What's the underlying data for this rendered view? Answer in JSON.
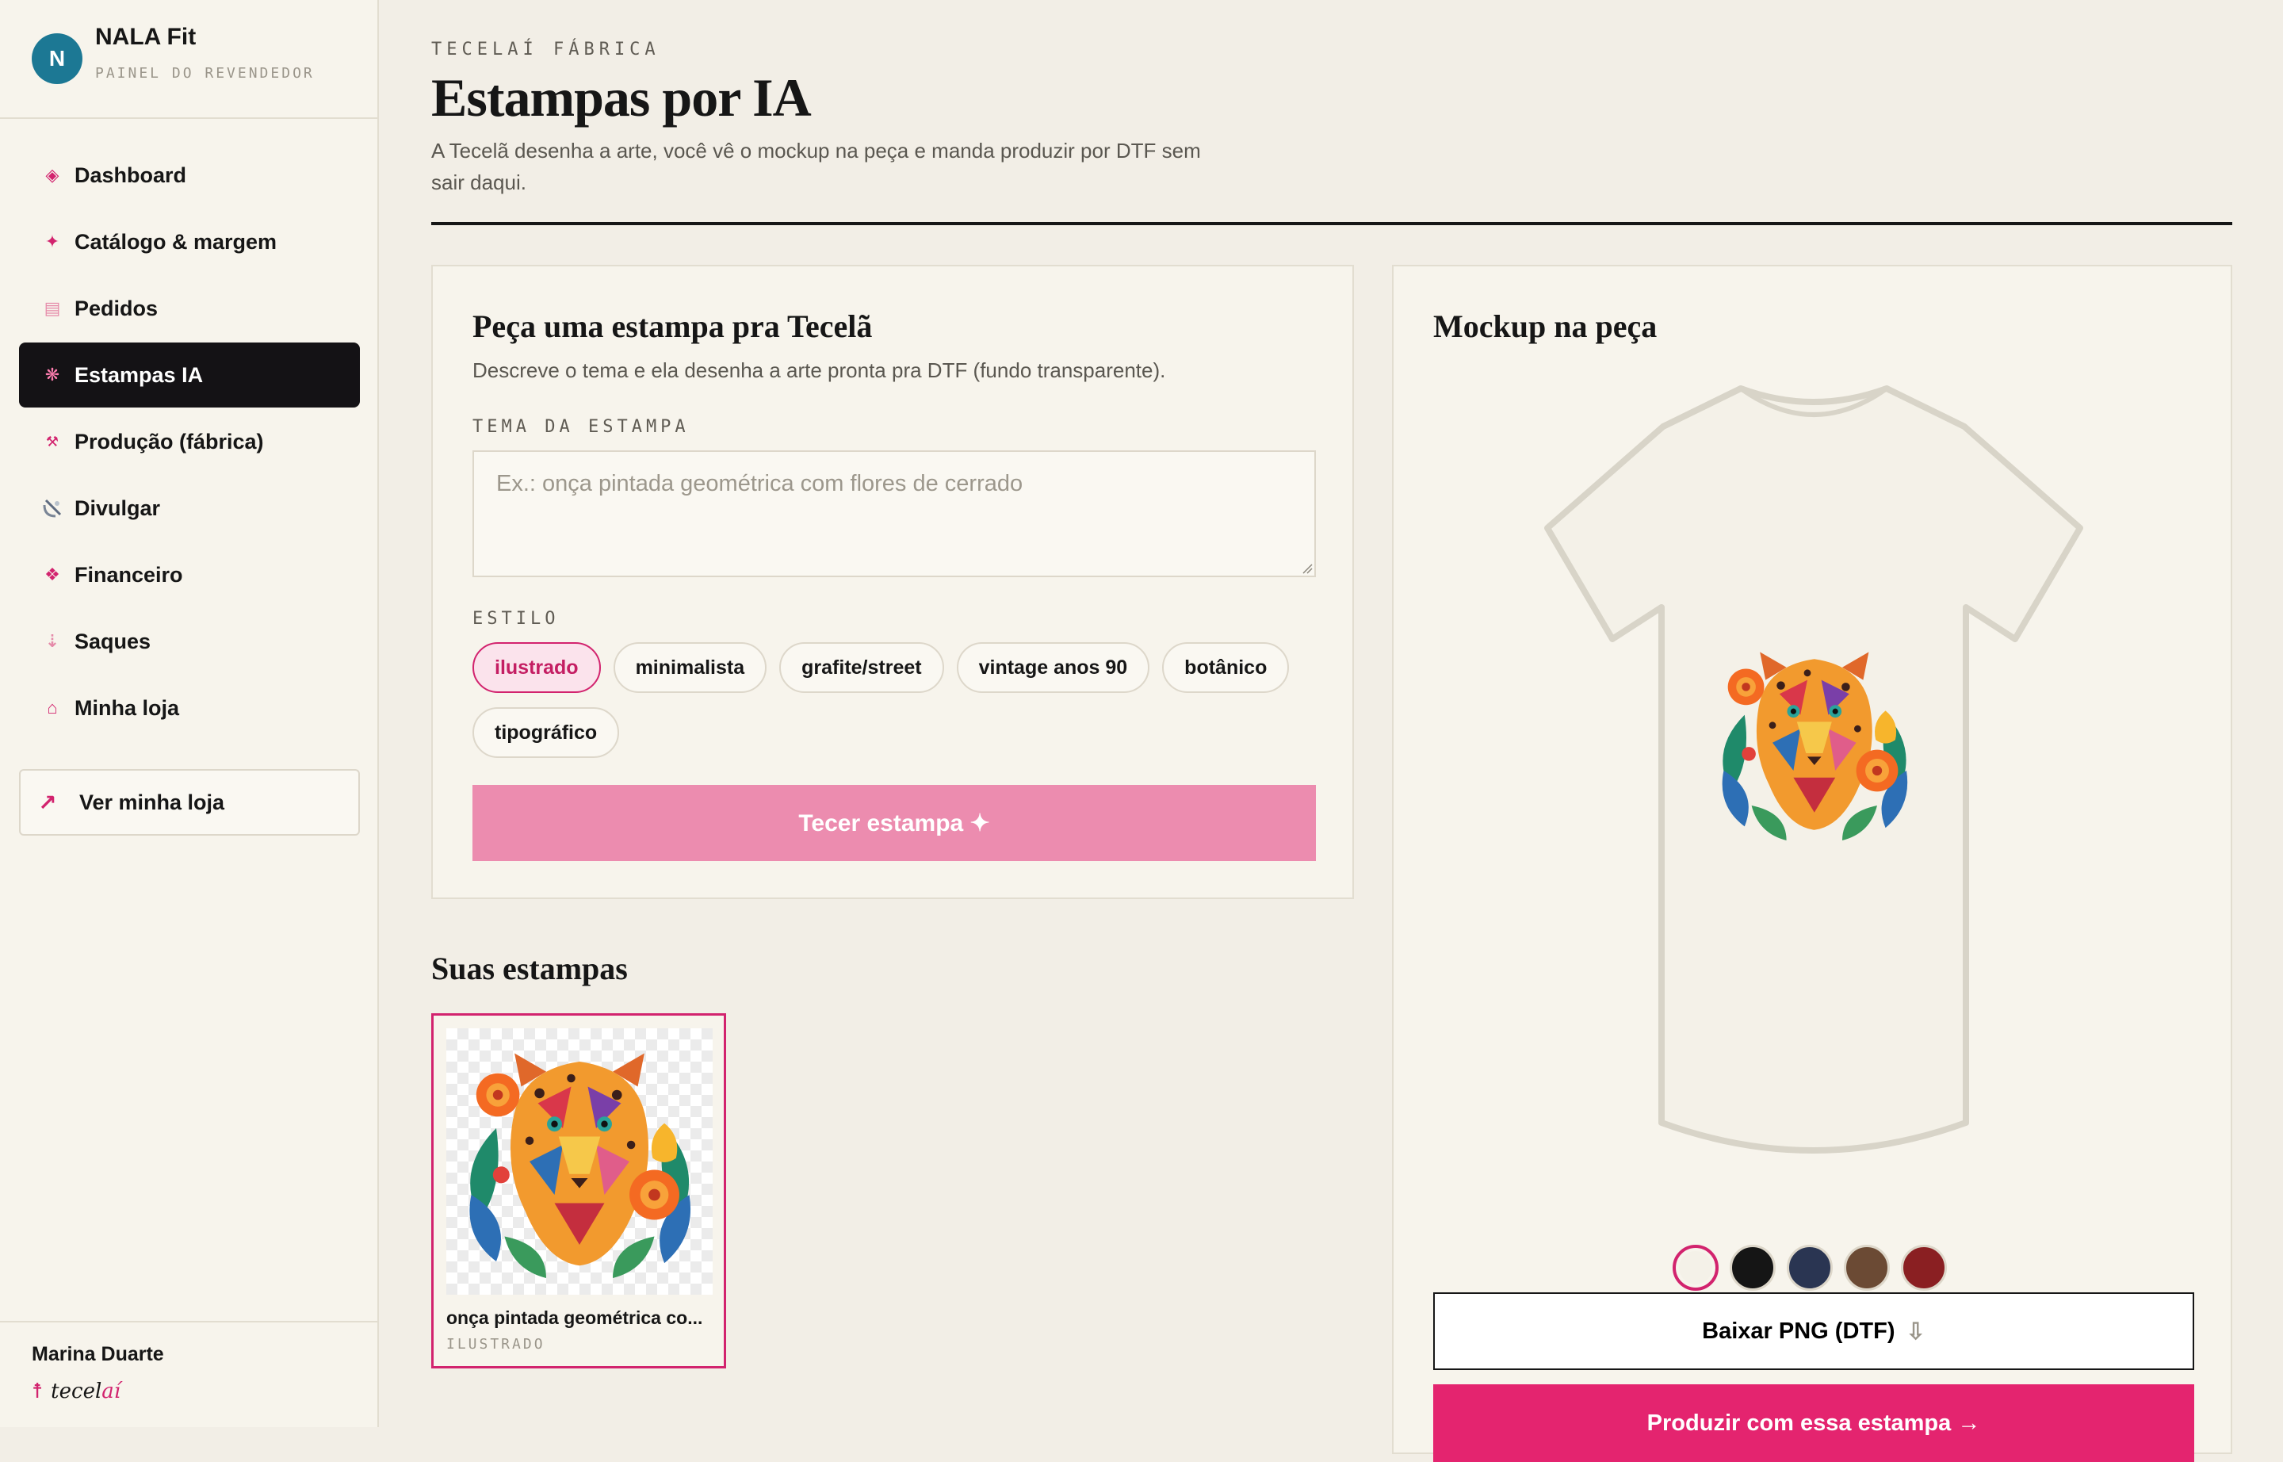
{
  "sidebar": {
    "avatar_letter": "N",
    "store_name": "NALA Fit",
    "store_subtitle": "PAINEL DO REVENDEDOR",
    "nav": [
      {
        "label": "Dashboard",
        "icon": "diamond-icon"
      },
      {
        "label": "Catálogo & margem",
        "icon": "sparkle-icon"
      },
      {
        "label": "Pedidos",
        "icon": "list-icon"
      },
      {
        "label": "Estampas IA",
        "icon": "asterisk-icon",
        "active": true
      },
      {
        "label": "Produção (fábrica)",
        "icon": "tools-icon"
      },
      {
        "label": "Divulgar",
        "icon": "satellite-icon"
      },
      {
        "label": "Financeiro",
        "icon": "diamond-cluster-icon"
      },
      {
        "label": "Saques",
        "icon": "down-arrow-icon"
      },
      {
        "label": "Minha loja",
        "icon": "house-icon"
      }
    ],
    "view_store_label": "Ver minha loja",
    "user_name": "Marina Duarte",
    "footer_logo_prefix": "tecel",
    "footer_logo_suffix": "aí"
  },
  "header": {
    "eyebrow": "TECELAÍ FÁBRICA",
    "title": "Estampas por IA",
    "description": "A Tecelã desenha a arte, você vê o mockup na peça e manda produzir por DTF sem sair daqui."
  },
  "generator": {
    "title": "Peça uma estampa pra Tecelã",
    "subtitle": "Descreve o tema e ela desenha a arte pronta pra DTF (fundo transparente).",
    "theme_label": "TEMA DA ESTAMPA",
    "theme_value": "",
    "theme_placeholder": "Ex.: onça pintada geométrica com flores de cerrado",
    "style_label": "ESTILO",
    "styles": [
      "ilustrado",
      "minimalista",
      "grafite/street",
      "vintage anos 90",
      "botânico",
      "tipográfico"
    ],
    "selected_style": "ilustrado",
    "submit_label": "Tecer estampa ✦"
  },
  "gallery": {
    "title": "Suas estampas",
    "items": [
      {
        "name": "onça pintada geométrica co...",
        "style": "ILUSTRADO",
        "selected": true
      }
    ]
  },
  "mockup": {
    "title": "Mockup na peça",
    "shirt_color": "#f4f1e8",
    "colors": [
      {
        "name": "off-white",
        "hex": "#f4f1e8",
        "selected": true
      },
      {
        "name": "preto",
        "hex": "#151515"
      },
      {
        "name": "marinho",
        "hex": "#2a3552"
      },
      {
        "name": "marrom",
        "hex": "#6b4a34"
      },
      {
        "name": "vinho",
        "hex": "#8a1f22"
      }
    ],
    "download_label": "Baixar PNG (DTF)",
    "download_icon": "⇩",
    "produce_label": "Produzir com essa estampa →"
  },
  "colors": {
    "accent": "#d2236e",
    "cta_disabled": "#ec8caf",
    "cta": "#e4246f",
    "active_nav_bg": "#141215"
  }
}
